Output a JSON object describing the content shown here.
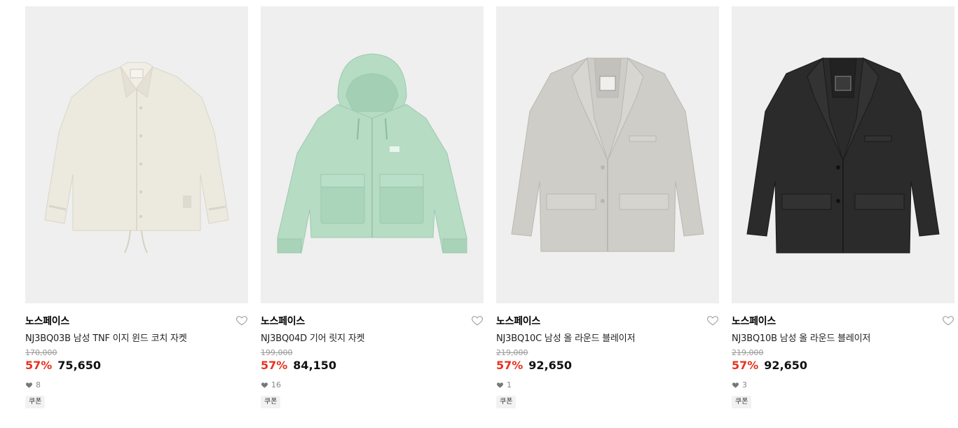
{
  "products": [
    {
      "brand": "노스페이스",
      "name": "NJ3BQ03B 남성 TNF 이지 윈드 코치 자켓",
      "original_price": "170,000",
      "discount": "57%",
      "price": "75,650",
      "likes": "8",
      "coupon": "쿠폰",
      "color": "#ece9df"
    },
    {
      "brand": "노스페이스",
      "name": "NJ3BQ04D 기어 릿지 자켓",
      "original_price": "199,000",
      "discount": "57%",
      "price": "84,150",
      "likes": "16",
      "coupon": "쿠폰",
      "color": "#b6dcc4"
    },
    {
      "brand": "노스페이스",
      "name": "NJ3BQ10C 남성 올 라운드 블레이저",
      "original_price": "219,000",
      "discount": "57%",
      "price": "92,650",
      "likes": "1",
      "coupon": "쿠폰",
      "color": "#cfcdc8"
    },
    {
      "brand": "노스페이스",
      "name": "NJ3BQ10B 남성 올 라운드 블레이저",
      "original_price": "219,000",
      "discount": "57%",
      "price": "92,650",
      "likes": "3",
      "coupon": "쿠폰",
      "color": "#2b2b2b"
    }
  ],
  "icons": {
    "wish": "heart-outline-icon",
    "likes": "heart-filled-icon"
  }
}
